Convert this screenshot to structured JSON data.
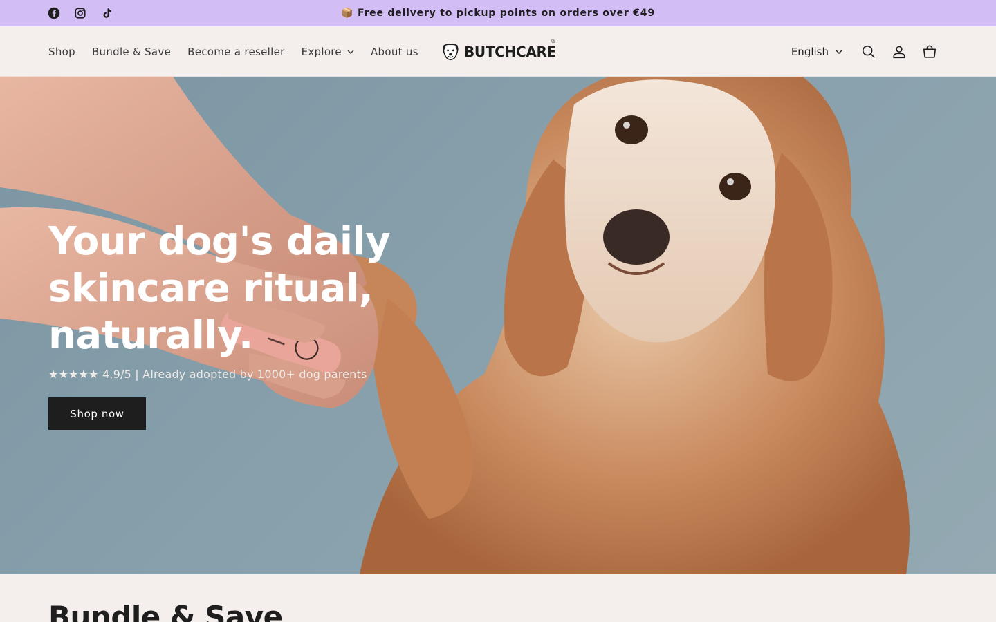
{
  "announcement": {
    "text": "📦 Free delivery to pickup points on orders over €49",
    "social": [
      "facebook-icon",
      "instagram-icon",
      "tiktok-icon"
    ]
  },
  "nav": {
    "items": [
      {
        "label": "Shop"
      },
      {
        "label": "Bundle & Save"
      },
      {
        "label": "Become a reseller"
      },
      {
        "label": "Explore"
      },
      {
        "label": "About us"
      }
    ]
  },
  "logo": {
    "text": "BUTCHCARE",
    "reg": "®"
  },
  "header_right": {
    "language": "English",
    "icons": [
      "search-icon",
      "account-icon",
      "cart-icon"
    ]
  },
  "hero": {
    "title_line1": "Your dog's daily",
    "title_line2": "skincare ritual,",
    "title_line3": "naturally.",
    "subtitle": "★★★★★ 4,9/5 | Already adopted by 1000+ dog parents",
    "button": "Shop now"
  },
  "next_section": {
    "title": "Bundle & Save"
  },
  "colors": {
    "announcement_bg": "#d3bdf5",
    "header_bg": "#f4efec",
    "button_bg": "#1e1e1e",
    "hero_bg": "#87a0ac"
  }
}
